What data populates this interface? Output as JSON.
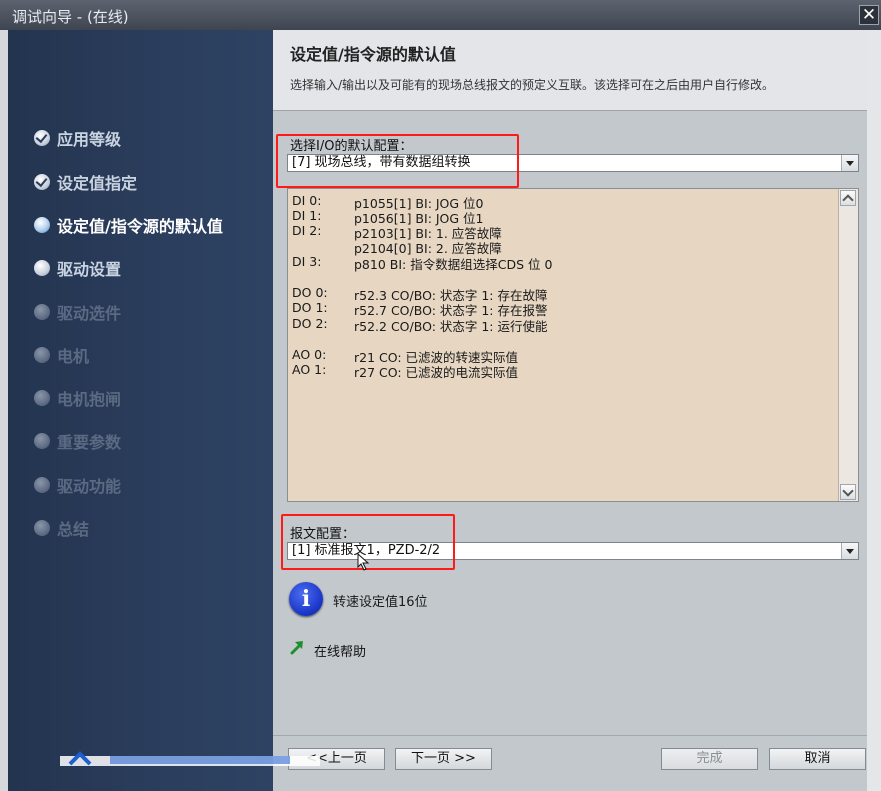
{
  "window": {
    "title": "调试向导 - (在线)",
    "close_glyph": "✕"
  },
  "sidebar": {
    "items": [
      {
        "label": "应用等级",
        "state": "done"
      },
      {
        "label": "设定值指定",
        "state": "done"
      },
      {
        "label": "设定值/指令源的默认值",
        "state": "current"
      },
      {
        "label": "驱动设置",
        "state": "enabled"
      },
      {
        "label": "驱动选件",
        "state": "disabled"
      },
      {
        "label": "电机",
        "state": "disabled"
      },
      {
        "label": "电机抱闸",
        "state": "disabled"
      },
      {
        "label": "重要参数",
        "state": "disabled"
      },
      {
        "label": "驱动功能",
        "state": "disabled"
      },
      {
        "label": "总结",
        "state": "disabled"
      }
    ]
  },
  "header": {
    "title": "设定值/指令源的默认值",
    "description": "选择输入/输出以及可能有的现场总线报文的预定义互联。该选择可在之后由用户自行修改。"
  },
  "io_config": {
    "label": "选择I/O的默认配置：",
    "selected": "[7] 现场总线，带有数据组转换",
    "lines": [
      {
        "key": "DI 0:",
        "value": "p1055[1] BI: JOG 位0"
      },
      {
        "key": "DI 1:",
        "value": "p1056[1] BI: JOG 位1"
      },
      {
        "key": "DI 2:",
        "value": "p2103[1] BI: 1. 应答故障"
      },
      {
        "key": "",
        "value": "p2104[0] BI: 2. 应答故障"
      },
      {
        "key": "DI 3:",
        "value": "p810 BI: 指令数据组选择CDS 位 0"
      },
      {
        "key": "DO 0:",
        "value": "r52.3 CO/BO: 状态字 1: 存在故障"
      },
      {
        "key": "DO 1:",
        "value": "r52.7 CO/BO: 状态字 1: 存在报警"
      },
      {
        "key": "DO 2:",
        "value": "r52.2 CO/BO: 状态字 1: 运行使能"
      },
      {
        "key": "AO 0:",
        "value": "r21 CO: 已滤波的转速实际值"
      },
      {
        "key": "AO 1:",
        "value": "r27 CO: 已滤波的电流实际值"
      }
    ]
  },
  "telegram": {
    "label": "报文配置：",
    "selected": "[1] 标准报文1，PZD-2/2"
  },
  "info": {
    "icon": "info-icon",
    "text": "转速设定值16位"
  },
  "help": {
    "icon": "green-arrow-icon",
    "label": "在线帮助"
  },
  "buttons": {
    "prev": "<<上一页",
    "next": "下一页 >>",
    "finish": "完成",
    "cancel": "取消"
  },
  "colors": {
    "sidebar_bg": "#2b3e5d",
    "highlight_red": "#ff1a1a",
    "io_box_bg": "#e6d6c2",
    "info_blue": "#1b37c9"
  }
}
